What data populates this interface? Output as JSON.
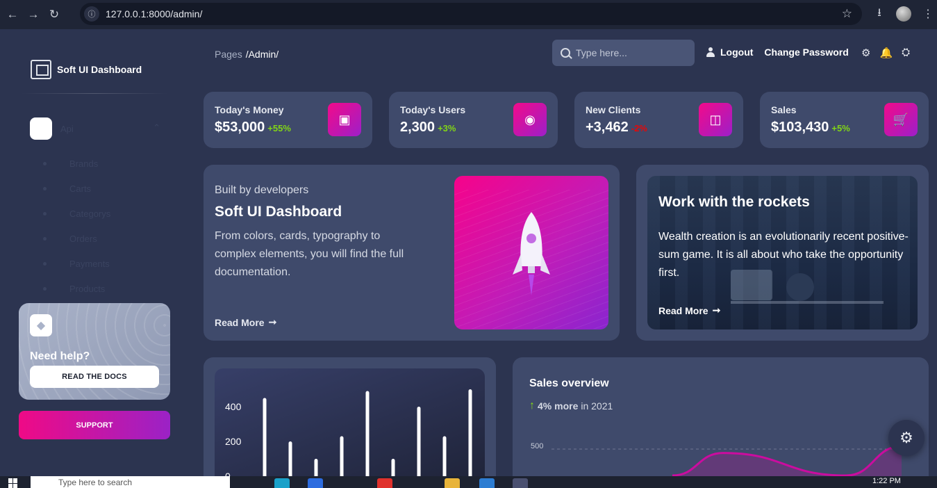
{
  "browser": {
    "url": "127.0.0.1:8000/admin/"
  },
  "sidebar": {
    "brand": "Soft UI Dashboard",
    "group": {
      "label": "Api"
    },
    "items": [
      {
        "label": "Brands"
      },
      {
        "label": "Carts"
      },
      {
        "label": "Categorys"
      },
      {
        "label": "Orders"
      },
      {
        "label": "Payments"
      },
      {
        "label": "Products"
      }
    ],
    "help": {
      "title": "Need help?",
      "button": "READ THE DOCS"
    },
    "support": "SUPPORT"
  },
  "header": {
    "breadcrumb_root": "Pages",
    "breadcrumb_current": "/Admin/",
    "search_placeholder": "Type here...",
    "logout": "Logout",
    "change_password": "Change Password"
  },
  "stats": [
    {
      "title": "Today's Money",
      "value": "$53,000",
      "change": "+55%",
      "positive": true,
      "icon": "money-icon"
    },
    {
      "title": "Today's Users",
      "value": "2,300",
      "change": "+3%",
      "positive": true,
      "icon": "globe-icon"
    },
    {
      "title": "New Clients",
      "value": "+3,462",
      "change": "-2%",
      "positive": false,
      "icon": "clients-icon"
    },
    {
      "title": "Sales",
      "value": "$103,430",
      "change": "+5%",
      "positive": true,
      "icon": "cart-icon"
    }
  ],
  "dev_card": {
    "kicker": "Built by developers",
    "title": "Soft UI Dashboard",
    "body": "From colors, cards, typography to complex elements, you will find the full documentation.",
    "read_more": "Read More"
  },
  "rockets_card": {
    "title": "Work with the rockets",
    "body": "Wealth creation is an evolutionarily recent positive-sum game. It is all about who take the opportunity first.",
    "read_more": "Read More"
  },
  "sales_overview": {
    "title": "Sales overview",
    "highlight": "4% more",
    "suffix": "in 2021",
    "tick_500": "500"
  },
  "taskbar": {
    "search_placeholder": "Type here to search",
    "time": "1:22 PM"
  },
  "colors": {
    "accent_gradient_start": "#f20a8a",
    "accent_gradient_end": "#9d1fc9",
    "positive": "#82d616",
    "negative": "#ea0606",
    "card_bg": "#3f4a6b",
    "page_bg": "#2c3450"
  },
  "chart_data": [
    {
      "type": "bar",
      "title": "",
      "yticks": [
        "400",
        "200",
        "0"
      ],
      "ylim": [
        0,
        500
      ],
      "values": [
        450,
        200,
        100,
        230,
        490,
        100,
        400,
        230,
        500
      ],
      "grid": false,
      "legend": "none"
    },
    {
      "type": "line",
      "title": "Sales overview",
      "yticks": [
        "500"
      ],
      "grid": true,
      "series": [
        {
          "values": [
            250,
            520,
            250,
            600
          ]
        }
      ]
    }
  ]
}
